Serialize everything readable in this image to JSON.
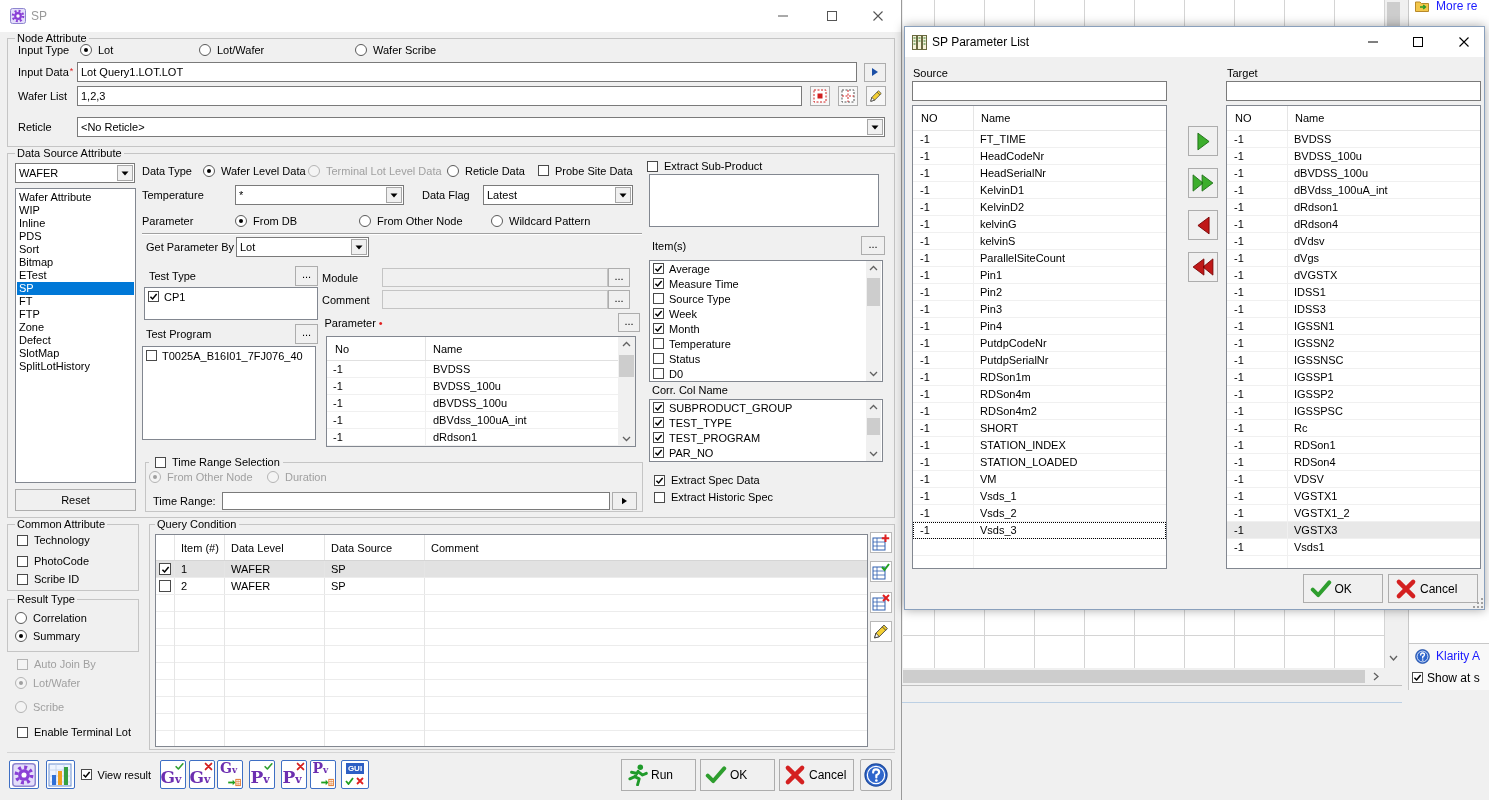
{
  "sp_window": {
    "title": "SP",
    "node_attribute": {
      "title": "Node Attribute",
      "input_type": {
        "label": "Input Type",
        "options": [
          {
            "label": "Lot",
            "selected": true
          },
          {
            "label": "Lot/Wafer",
            "selected": false
          },
          {
            "label": "Wafer Scribe",
            "selected": false
          }
        ]
      },
      "input_data": {
        "label": "Input Data",
        "required_mark": "*",
        "value": "Lot Query1.LOT.LOT"
      },
      "wafer_list": {
        "label": "Wafer List",
        "value": "1,2,3"
      },
      "reticle": {
        "label": "Reticle",
        "value": "<No Reticle>"
      }
    },
    "data_source_attribute": {
      "title": "Data Source Attribute",
      "data_level": "WAFER",
      "sources": [
        {
          "label": "Wafer Attribute",
          "selected": false
        },
        {
          "label": "WIP",
          "selected": false
        },
        {
          "label": "Inline",
          "selected": false
        },
        {
          "label": "PDS",
          "selected": false
        },
        {
          "label": "Sort",
          "selected": false
        },
        {
          "label": "Bitmap",
          "selected": false
        },
        {
          "label": "ETest",
          "selected": false
        },
        {
          "label": "SP",
          "selected": true
        },
        {
          "label": "FT",
          "selected": false
        },
        {
          "label": "FTP",
          "selected": false
        },
        {
          "label": "Zone",
          "selected": false
        },
        {
          "label": "Defect",
          "selected": false
        },
        {
          "label": "SlotMap",
          "selected": false
        },
        {
          "label": "SplitLotHistory",
          "selected": false
        }
      ],
      "reset_button": "Reset",
      "data_type": {
        "label": "Data Type",
        "options": [
          {
            "label": "Wafer Level Data",
            "selected": true,
            "disabled": false
          },
          {
            "label": "Terminal Lot Level Data",
            "selected": false,
            "disabled": true
          },
          {
            "label": "Reticle Data",
            "selected": false,
            "disabled": false
          }
        ]
      },
      "probe_site_data": {
        "label": "Probe Site Data",
        "checked": false
      },
      "temperature": {
        "label": "Temperature",
        "value": "*"
      },
      "data_flag": {
        "label": "Data Flag",
        "value": "Latest"
      },
      "parameter_source": {
        "label": "Parameter",
        "options": [
          {
            "label": "From DB",
            "selected": true
          },
          {
            "label": "From Other Node",
            "selected": false
          },
          {
            "label": "Wildcard Pattern",
            "selected": false
          }
        ]
      },
      "get_parameter_by": {
        "label": "Get Parameter By",
        "value": "Lot"
      },
      "test_type": {
        "label": "Test Type",
        "button": "...",
        "items": [
          {
            "label": "CP1",
            "checked": true
          }
        ]
      },
      "test_program": {
        "label": "Test Program",
        "button": "...",
        "items": [
          {
            "label": "T0025A_B16I01_7FJ076_40",
            "checked": false
          }
        ]
      },
      "module": {
        "label": "Module",
        "disabled": true,
        "button": "..."
      },
      "comment": {
        "label": "Comment",
        "disabled": true,
        "button": "..."
      },
      "parameter": {
        "label": "Parameter",
        "required_mark": "•",
        "button": "...",
        "columns": [
          "No",
          "Name"
        ],
        "rows": [
          {
            "no": "-1",
            "name": "BVDSS"
          },
          {
            "no": "-1",
            "name": "BVDSS_100u"
          },
          {
            "no": "-1",
            "name": "dBVDSS_100u"
          },
          {
            "no": "-1",
            "name": "dBVdss_100uA_int"
          },
          {
            "no": "-1",
            "name": "dRdson1"
          }
        ]
      },
      "time_range_selection": {
        "label": "Time Range Selection",
        "checked": false,
        "options": [
          {
            "label": "From Other Node",
            "selected": true,
            "disabled": true
          },
          {
            "label": "Duration",
            "selected": false,
            "disabled": true
          }
        ],
        "time_range_label": "Time Range:"
      },
      "extract_sub_product": {
        "label": "Extract Sub-Product",
        "checked": false
      },
      "items": {
        "label": "Item(s)",
        "button": "...",
        "entries": [
          {
            "label": "Average",
            "checked": true
          },
          {
            "label": "Measure Time",
            "checked": true
          },
          {
            "label": "Source Type",
            "checked": false
          },
          {
            "label": "Week",
            "checked": true
          },
          {
            "label": "Month",
            "checked": true
          },
          {
            "label": "Temperature",
            "checked": false
          },
          {
            "label": "Status",
            "checked": false
          },
          {
            "label": "D0",
            "checked": false
          }
        ]
      },
      "corr_col_name": {
        "label": "Corr. Col Name",
        "entries": [
          {
            "label": "SUBPRODUCT_GROUP",
            "checked": true
          },
          {
            "label": "TEST_TYPE",
            "checked": true
          },
          {
            "label": "TEST_PROGRAM",
            "checked": true
          },
          {
            "label": "PAR_NO",
            "checked": true
          }
        ]
      },
      "extract_spec_data": {
        "label": "Extract Spec Data",
        "checked": true
      },
      "extract_historic_spec": {
        "label": "Extract Historic Spec",
        "checked": false
      }
    },
    "common_attribute": {
      "title": "Common Attribute",
      "options": [
        {
          "label": "Technology",
          "checked": false
        },
        {
          "label": "PhotoCode",
          "checked": false
        },
        {
          "label": "Scribe ID",
          "checked": false
        }
      ]
    },
    "result_type": {
      "title": "Result Type",
      "options": [
        {
          "label": "Correlation",
          "selected": false
        },
        {
          "label": "Summary",
          "selected": true
        }
      ]
    },
    "auto_join_by": {
      "label": "Auto Join By",
      "checked": false,
      "disabled": true,
      "options": [
        {
          "label": "Lot/Wafer",
          "selected": true
        },
        {
          "label": "Scribe",
          "selected": false
        }
      ]
    },
    "enable_terminal_lot": {
      "label": "Enable Terminal Lot",
      "checked": false
    },
    "query_condition": {
      "title": "Query Condition",
      "columns": [
        "Item (#)",
        "Data Level",
        "Data Source",
        "Comment"
      ],
      "rows": [
        {
          "checked": true,
          "selected": true,
          "cells": [
            "1",
            "WAFER",
            "SP"
          ]
        },
        {
          "checked": false,
          "selected": false,
          "cells": [
            "2",
            "WAFER",
            "SP"
          ]
        }
      ]
    },
    "footer": {
      "view_result": {
        "label": "View result",
        "checked": true
      },
      "tool_buttons": [
        {
          "glyph": "Gv",
          "kind": "check"
        },
        {
          "glyph": "Gv",
          "kind": "cross"
        },
        {
          "glyph": "Gv",
          "kind": "table"
        },
        {
          "glyph": "Pv",
          "kind": "check"
        },
        {
          "glyph": "Pv",
          "kind": "cross"
        },
        {
          "glyph": "Pv",
          "kind": "table"
        },
        {
          "glyph": "GUI",
          "kind": "checkcross"
        }
      ],
      "buttons": [
        {
          "label": "Run",
          "kind": "run"
        },
        {
          "label": "OK",
          "kind": "ok"
        },
        {
          "label": "Cancel",
          "kind": "cancel"
        }
      ]
    }
  },
  "parameter_list_window": {
    "title": "SP Parameter List",
    "source": {
      "label": "Source",
      "columns": [
        "NO",
        "Name"
      ],
      "rows": [
        {
          "no": "-1",
          "name": "FT_TIME",
          "focused": false
        },
        {
          "no": "-1",
          "name": "HeadCodeNr",
          "focused": false
        },
        {
          "no": "-1",
          "name": "HeadSerialNr",
          "focused": false
        },
        {
          "no": "-1",
          "name": "KelvinD1",
          "focused": false
        },
        {
          "no": "-1",
          "name": "KelvinD2",
          "focused": false
        },
        {
          "no": "-1",
          "name": "kelvinG",
          "focused": false
        },
        {
          "no": "-1",
          "name": "kelvinS",
          "focused": false
        },
        {
          "no": "-1",
          "name": "ParallelSiteCount",
          "focused": false
        },
        {
          "no": "-1",
          "name": "Pin1",
          "focused": false
        },
        {
          "no": "-1",
          "name": "Pin2",
          "focused": false
        },
        {
          "no": "-1",
          "name": "Pin3",
          "focused": false
        },
        {
          "no": "-1",
          "name": "Pin4",
          "focused": false
        },
        {
          "no": "-1",
          "name": "PutdpCodeNr",
          "focused": false
        },
        {
          "no": "-1",
          "name": "PutdpSerialNr",
          "focused": false
        },
        {
          "no": "-1",
          "name": "RDSon1m",
          "focused": false
        },
        {
          "no": "-1",
          "name": "RDSon4m",
          "focused": false
        },
        {
          "no": "-1",
          "name": "RDSon4m2",
          "focused": false
        },
        {
          "no": "-1",
          "name": "SHORT",
          "focused": false
        },
        {
          "no": "-1",
          "name": "STATION_INDEX",
          "focused": false
        },
        {
          "no": "-1",
          "name": "STATION_LOADED",
          "focused": false
        },
        {
          "no": "-1",
          "name": "VM",
          "focused": false
        },
        {
          "no": "-1",
          "name": "Vsds_1",
          "focused": false
        },
        {
          "no": "-1",
          "name": "Vsds_2",
          "focused": false
        },
        {
          "no": "-1",
          "name": "Vsds_3",
          "focused": true
        }
      ]
    },
    "target": {
      "label": "Target",
      "columns": [
        "NO",
        "Name"
      ],
      "rows": [
        {
          "no": "-1",
          "name": "BVDSS",
          "selected": false
        },
        {
          "no": "-1",
          "name": "BVDSS_100u",
          "selected": false
        },
        {
          "no": "-1",
          "name": "dBVDSS_100u",
          "selected": false
        },
        {
          "no": "-1",
          "name": "dBVdss_100uA_int",
          "selected": false
        },
        {
          "no": "-1",
          "name": "dRdson1",
          "selected": false
        },
        {
          "no": "-1",
          "name": "dRdson4",
          "selected": false
        },
        {
          "no": "-1",
          "name": "dVdsv",
          "selected": false
        },
        {
          "no": "-1",
          "name": "dVgs",
          "selected": false
        },
        {
          "no": "-1",
          "name": "dVGSTX",
          "selected": false
        },
        {
          "no": "-1",
          "name": "IDSS1",
          "selected": false
        },
        {
          "no": "-1",
          "name": "IDSS3",
          "selected": false
        },
        {
          "no": "-1",
          "name": "IGSSN1",
          "selected": false
        },
        {
          "no": "-1",
          "name": "IGSSN2",
          "selected": false
        },
        {
          "no": "-1",
          "name": "IGSSNSC",
          "selected": false
        },
        {
          "no": "-1",
          "name": "IGSSP1",
          "selected": false
        },
        {
          "no": "-1",
          "name": "IGSSP2",
          "selected": false
        },
        {
          "no": "-1",
          "name": "IGSSPSC",
          "selected": false
        },
        {
          "no": "-1",
          "name": "Rc",
          "selected": false
        },
        {
          "no": "-1",
          "name": "RDSon1",
          "selected": false
        },
        {
          "no": "-1",
          "name": "RDSon4",
          "selected": false
        },
        {
          "no": "-1",
          "name": "VDSV",
          "selected": false
        },
        {
          "no": "-1",
          "name": "VGSTX1",
          "selected": false
        },
        {
          "no": "-1",
          "name": "VGSTX1_2",
          "selected": false
        },
        {
          "no": "-1",
          "name": "VGSTX3",
          "selected": true
        },
        {
          "no": "-1",
          "name": "Vsds1",
          "selected": false
        }
      ]
    },
    "buttons": [
      {
        "label": "OK",
        "kind": "ok"
      },
      {
        "label": "Cancel",
        "kind": "cancel"
      }
    ]
  },
  "background_app": {
    "top_link": "More re",
    "bottom_link": "Klarity A",
    "checkbox_option": {
      "label": "Show at s",
      "checked": true
    }
  }
}
